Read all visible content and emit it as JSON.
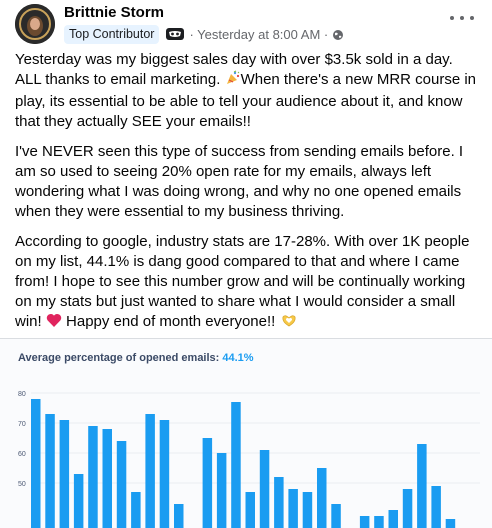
{
  "post": {
    "author": "Brittnie Storm",
    "badge": "Top Contributor",
    "time_text": "· Yesterday at 8:00 AM ·",
    "paragraphs": [
      {
        "text": "Yesterday was my biggest sales day with over $3.5k sold in a day. ALL thanks to email marketing.",
        "emoji": "party-popper-icon",
        "text2": "When there's a new MRR course in play, its essential to be able to tell your audience about it, and know that they actually SEE your emails!!"
      },
      {
        "text": "I've NEVER seen this type of success from sending emails before. I am so used to seeing 20% open rate for my emails, always left wondering what I was doing wrong, and why no one opened emails when they were essential to my business thriving."
      },
      {
        "text": "According to google, industry stats are 17-28%. With over 1K people on my list, 44.1% is dang good compared to that and where I came from! I hope to see this number grow and will be continually working on my stats but just wanted to share what I would consider a small win!",
        "emoji": "red-heart-icon",
        "text2": "Happy end of month everyone!!",
        "emoji2": "heart-hands-icon"
      }
    ]
  },
  "colors": {
    "accent": "#1a9cf1",
    "bar": "#1a9cf1",
    "badge_bg": "#e7f3ff",
    "meta": "#65676b"
  },
  "chart_data": {
    "type": "bar",
    "title": "Average percentage of opened emails:",
    "title_value": "44.1%",
    "ylim": [
      40,
      85
    ],
    "yticks": [
      50,
      60,
      70,
      80
    ],
    "grid": true,
    "values": [
      78,
      73,
      71,
      53,
      69,
      68,
      64,
      47,
      73,
      71,
      43,
      0,
      65,
      60,
      77,
      47,
      61,
      52,
      48,
      47,
      55,
      43,
      0,
      39,
      39,
      41,
      48,
      63,
      49,
      38
    ]
  }
}
